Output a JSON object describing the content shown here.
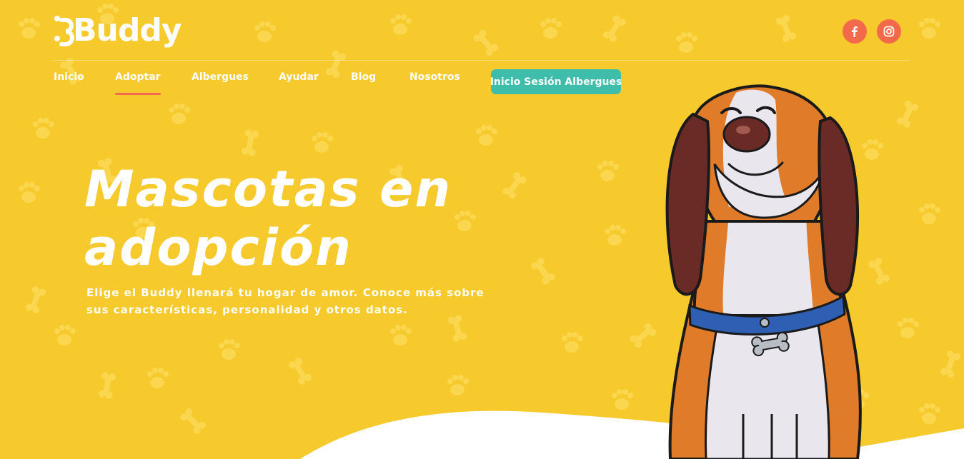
{
  "brand": {
    "name": "Buddy"
  },
  "social": {
    "facebook_icon": "facebook-icon",
    "instagram_icon": "instagram-icon"
  },
  "nav": {
    "items": [
      {
        "label": "Inicio",
        "active": false
      },
      {
        "label": "Adoptar",
        "active": true
      },
      {
        "label": "Albergues",
        "active": false
      },
      {
        "label": "Ayudar",
        "active": false
      },
      {
        "label": "Blog",
        "active": false
      },
      {
        "label": "Nosotros",
        "active": false
      }
    ],
    "login_label": "Inicio Sesión Albergues"
  },
  "hero": {
    "title_line1": "Mascotas en",
    "title_line2": "adopción",
    "subtitle": "Elige el Buddy llenará tu hogar de amor. Conoce más sobre sus características, personalidad y otros datos."
  },
  "colors": {
    "background": "#f6c92c",
    "accent": "#f26a4b",
    "button": "#3ebdab",
    "text": "#ffffff"
  }
}
